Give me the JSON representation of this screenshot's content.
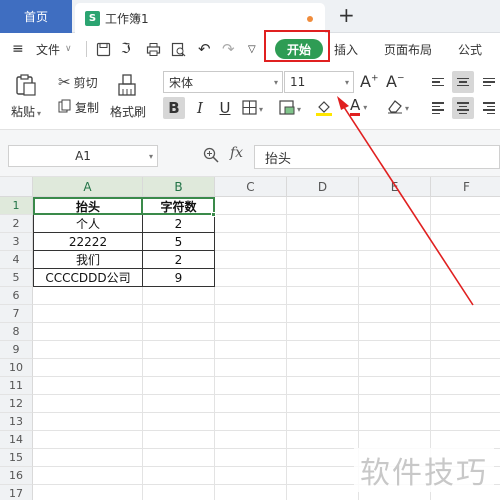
{
  "titlebar": {
    "home_tab": "首页",
    "doc_tab": "工作簿1",
    "doc_icon_letter": "S",
    "new_tab": "+"
  },
  "menubar": {
    "file_menu": "文件",
    "start": "开始",
    "insert": "插入",
    "page_layout": "页面布局",
    "formula": "公式"
  },
  "ribbon": {
    "paste": "粘贴",
    "cut": "剪切",
    "copy": "复制",
    "format_painter": "格式刷",
    "font_name": "宋体",
    "font_size": "11",
    "grow_font": "A",
    "shrink_font": "A",
    "bold": "B",
    "italic": "I",
    "underline": "U",
    "font_color_letter": "A"
  },
  "formula_bar": {
    "name_box": "A1",
    "fx": "fx",
    "value": "抬头"
  },
  "grid": {
    "columns": [
      "A",
      "B",
      "C",
      "D",
      "E",
      "F"
    ],
    "rows": [
      "1",
      "2",
      "3",
      "4",
      "5",
      "6",
      "7",
      "8",
      "9",
      "10",
      "11",
      "12",
      "13",
      "14",
      "15",
      "16",
      "17"
    ],
    "cells": [
      [
        "抬头",
        "字符数"
      ],
      [
        "个人",
        "2"
      ],
      [
        "22222",
        "5"
      ],
      [
        "我们",
        "2"
      ],
      [
        "CCCCDDD公司",
        "9"
      ]
    ]
  },
  "watermark": "软件技巧",
  "colors": {
    "home_tab": "#3f6ec1",
    "start_button": "#2e9c54",
    "annotation": "#e02020",
    "selection": "#3a8a4a"
  }
}
